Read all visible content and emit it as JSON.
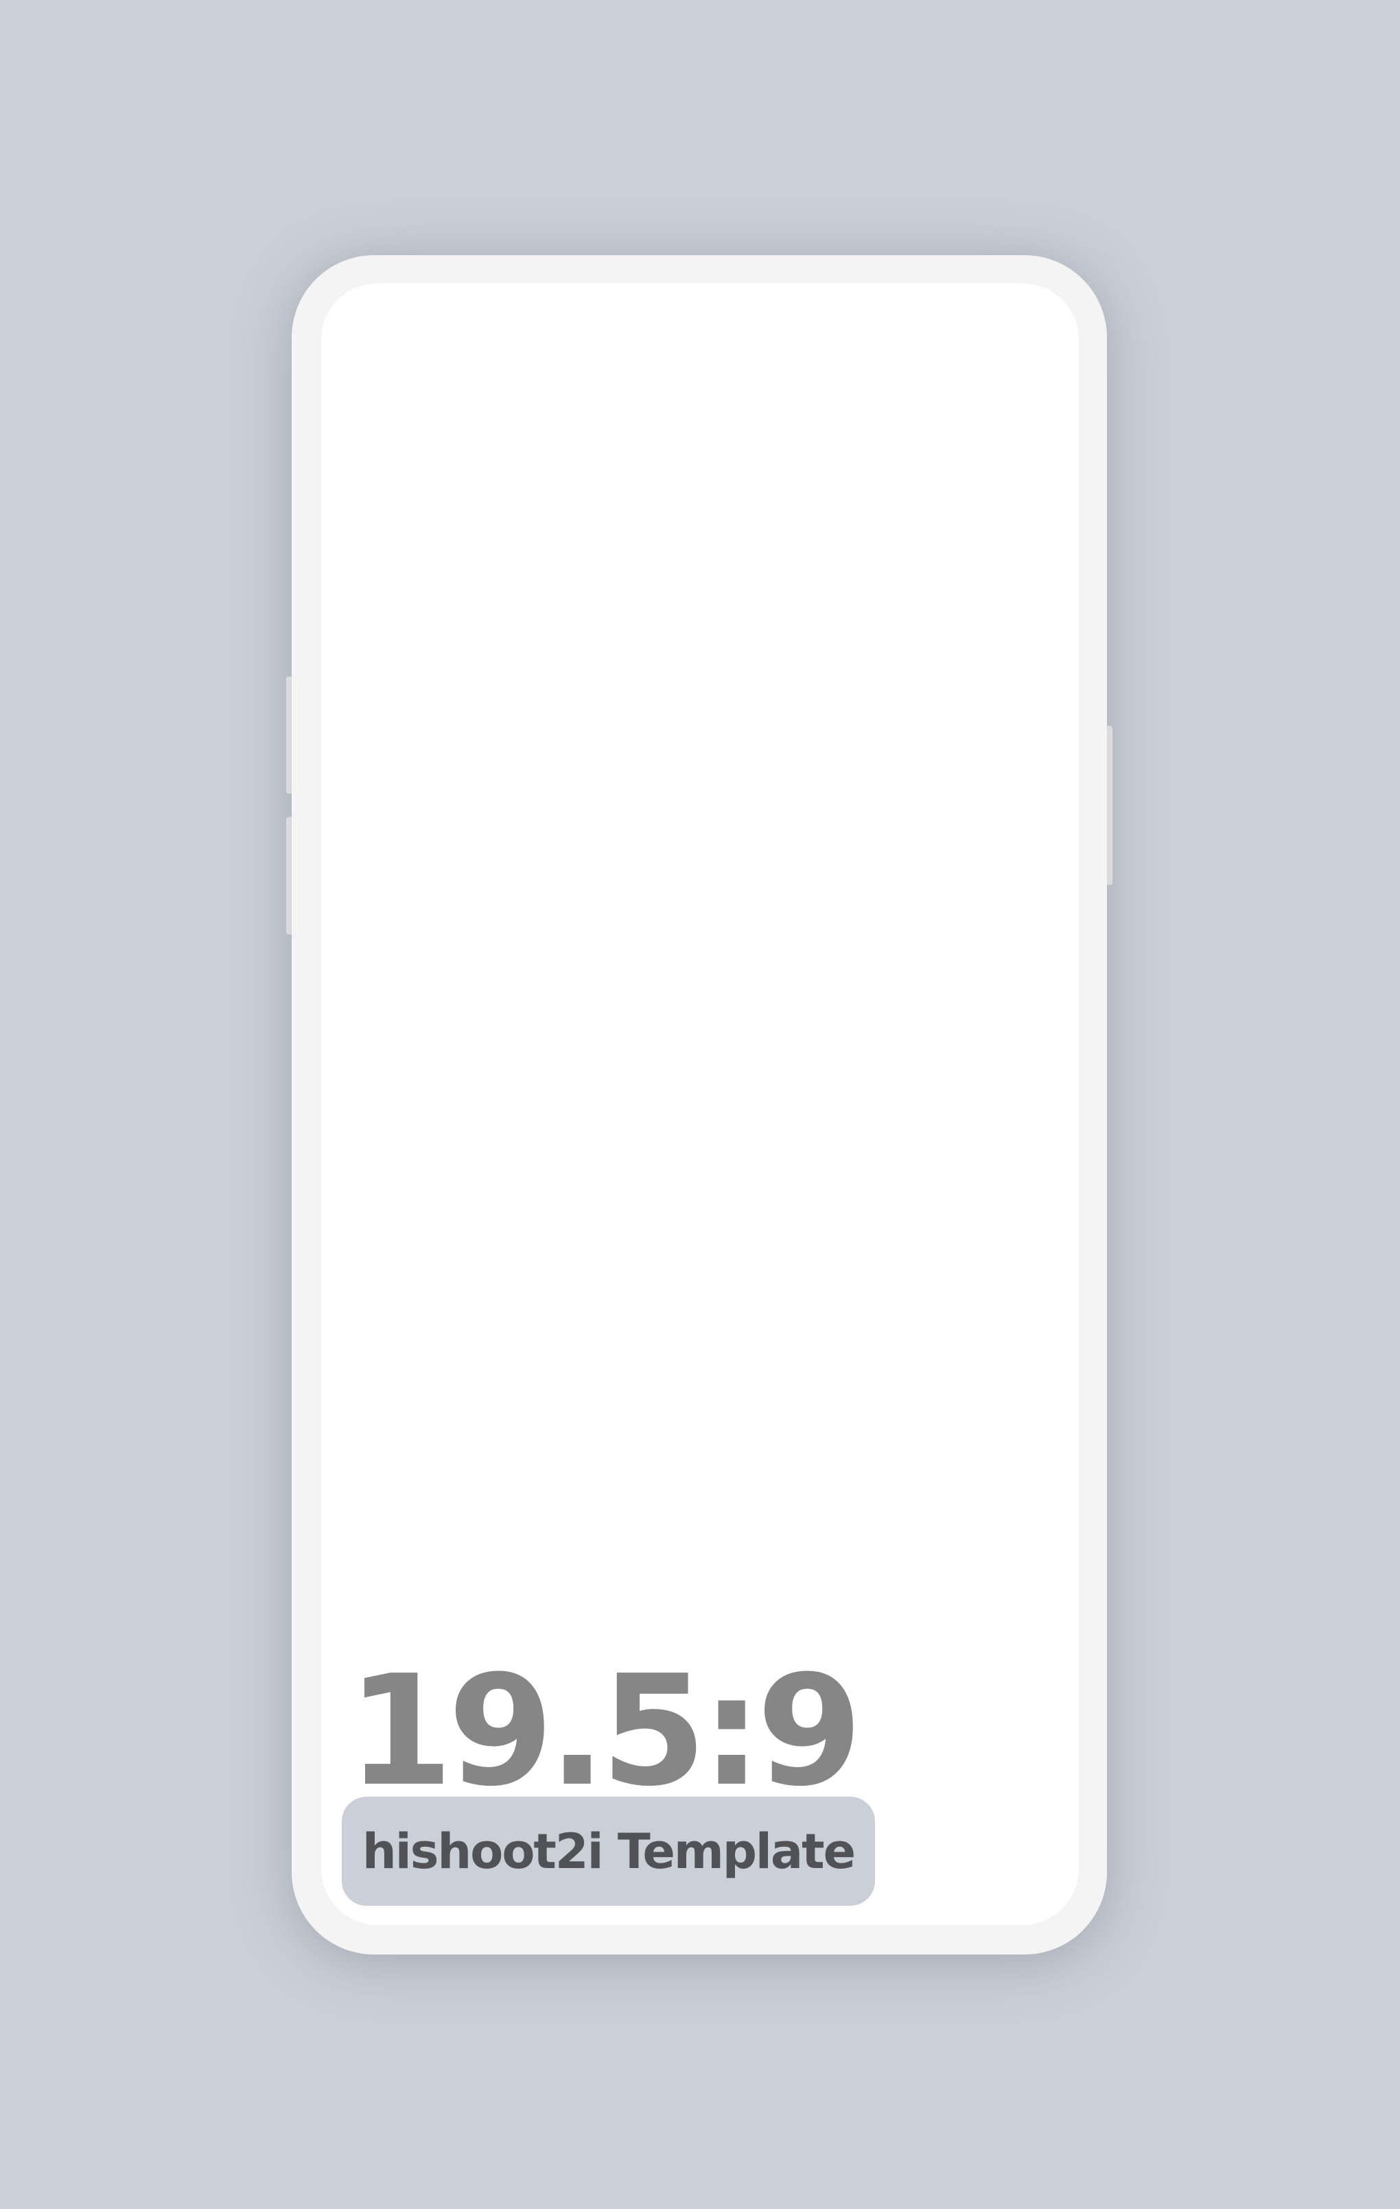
{
  "template": {
    "aspect_ratio": "19.5:9",
    "badge_label": "hishoot2i Template"
  },
  "colors": {
    "background": "#cbcfd7",
    "frame": "#f4f4f4",
    "screen": "#ffffff",
    "ratio_text": "#868686",
    "badge_bg": "#cbcfd7",
    "badge_text": "#515257"
  }
}
